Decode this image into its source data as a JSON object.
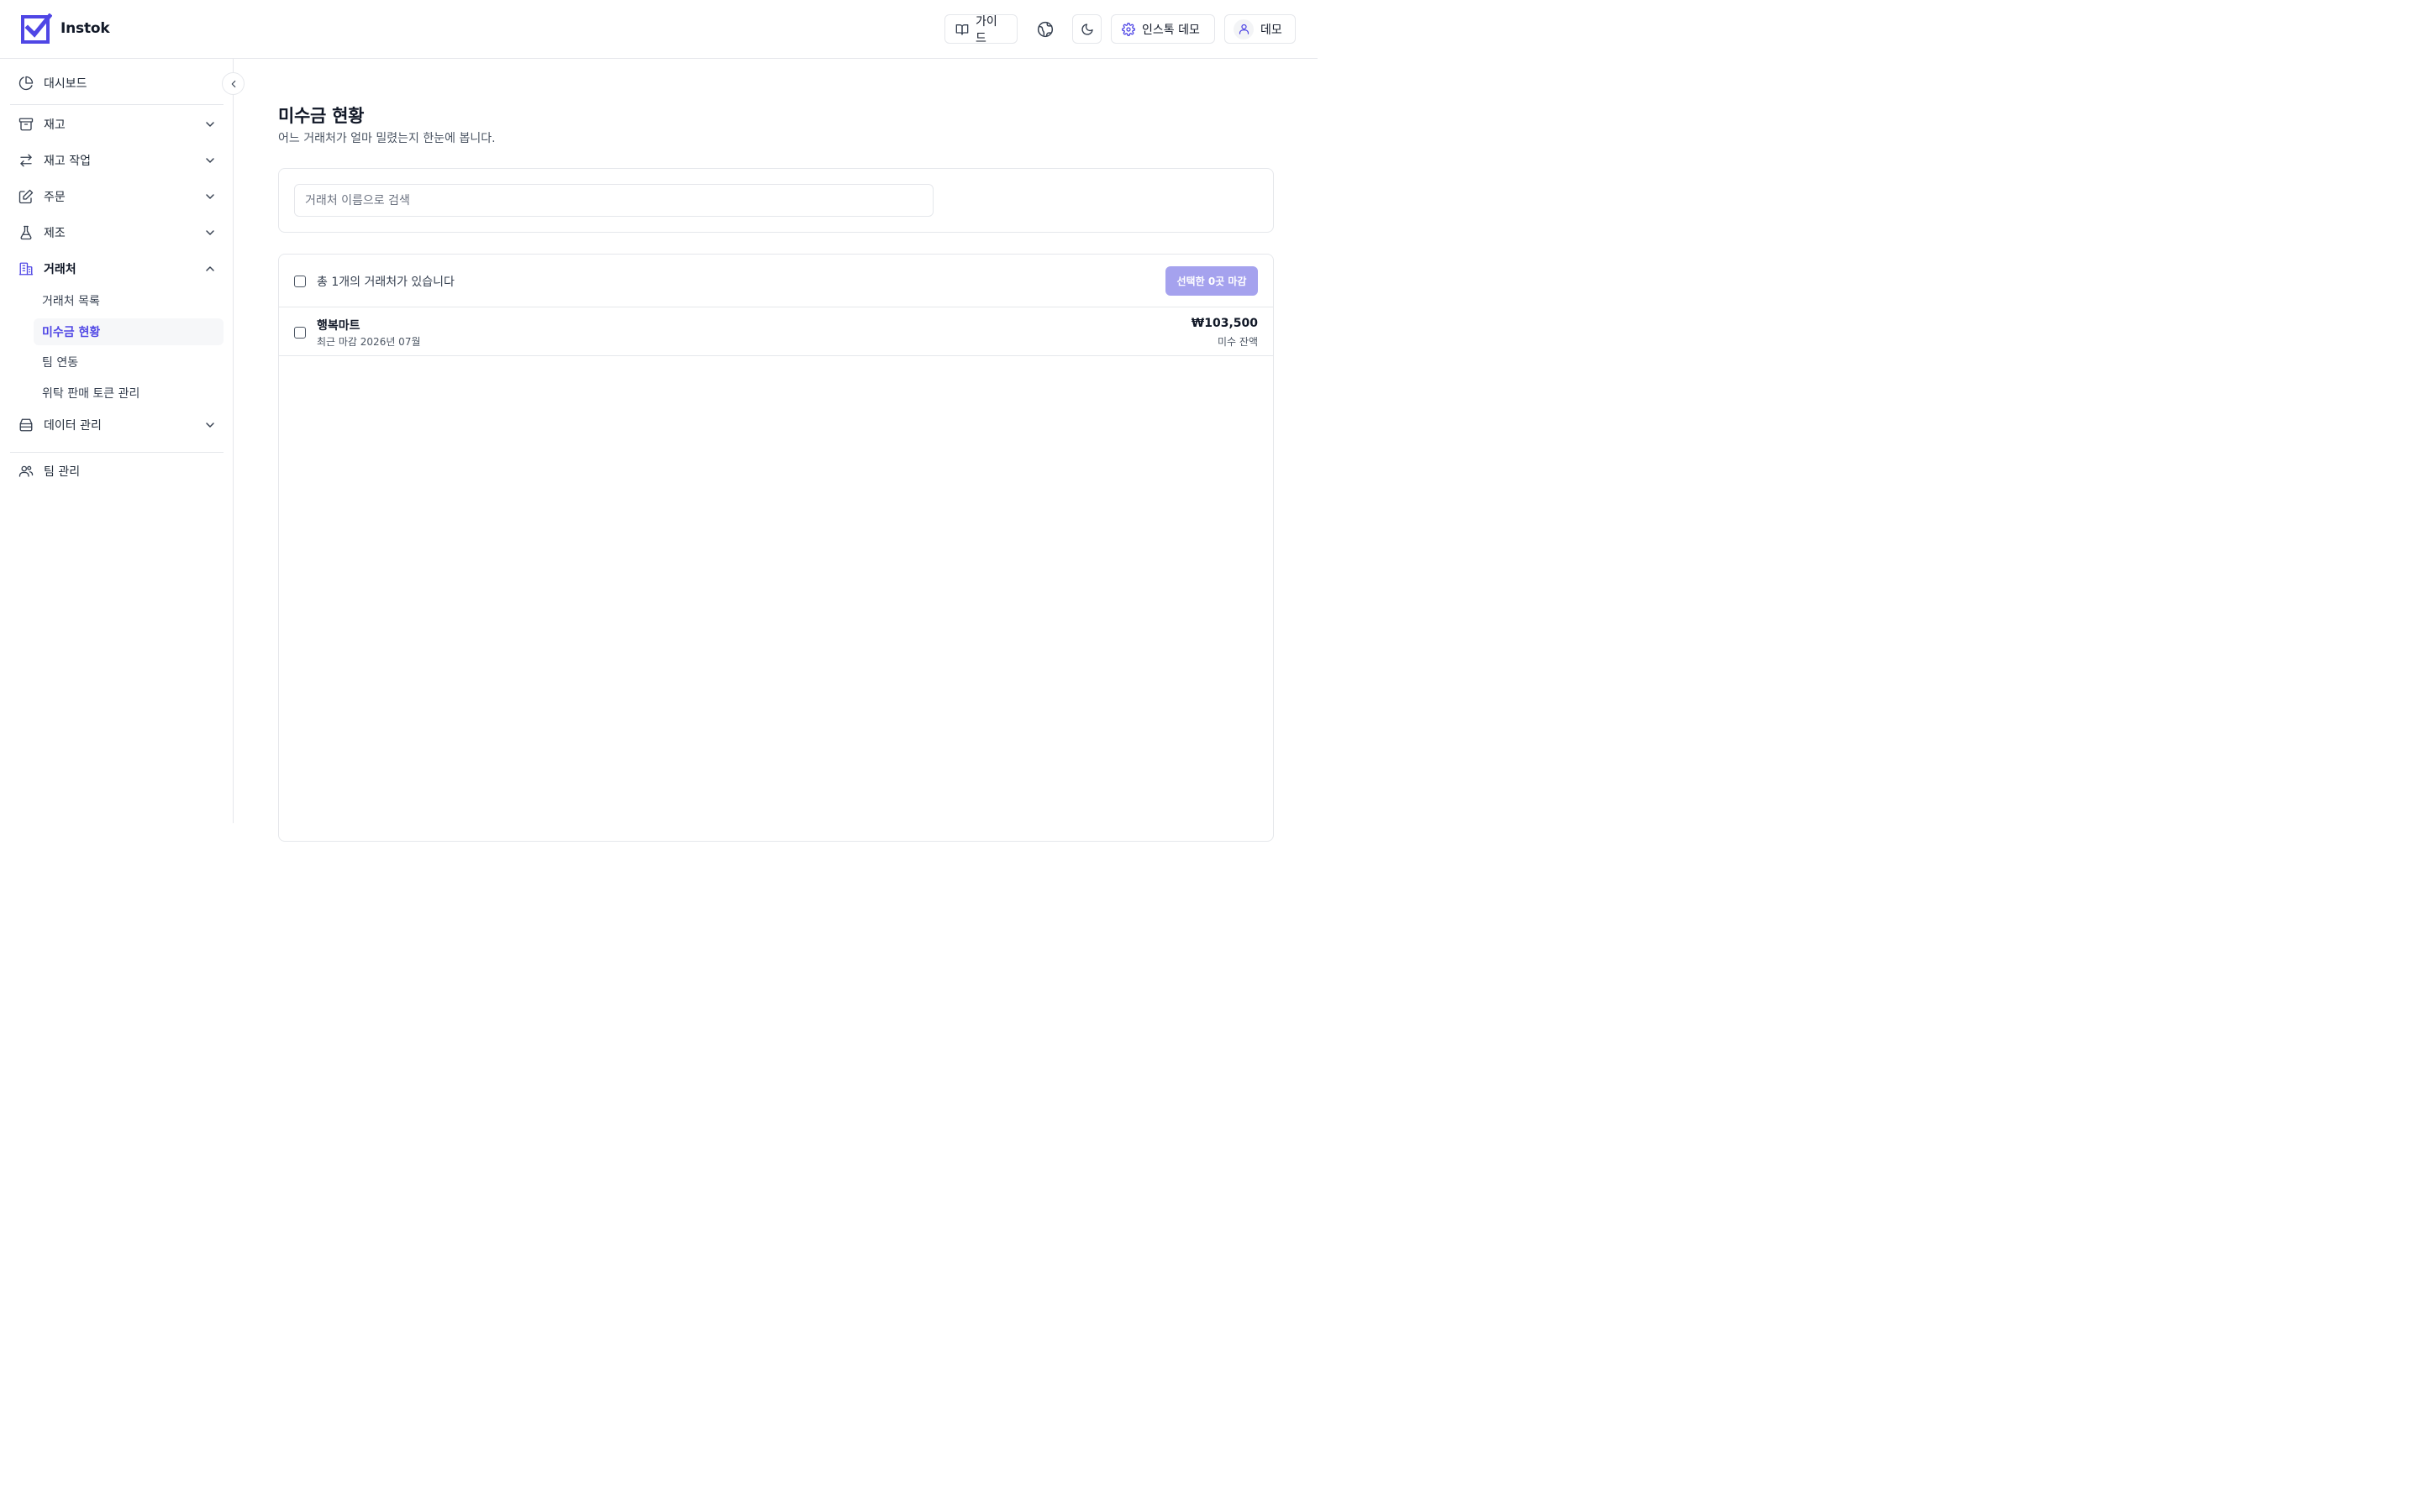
{
  "app": {
    "name": "Instok"
  },
  "header": {
    "guide_label": "가이드",
    "org_label": "인스톡 데모",
    "user_label": "데모"
  },
  "sidebar": {
    "dashboard": "대시보드",
    "inventory": "재고",
    "inventory_ops": "재고 작업",
    "orders": "주문",
    "manufacturing": "제조",
    "partners": "거래처",
    "partners_sub": [
      "거래처 목록",
      "미수금 현황",
      "팀 연동",
      "위탁 판매 토큰 관리"
    ],
    "data_mgmt": "데이터 관리",
    "team_mgmt": "팀 관리"
  },
  "main": {
    "title": "미수금 현황",
    "subtitle": "어느 거래처가 얼마 밀렸는지 한눈에 봅니다.",
    "search_placeholder": "거래처 이름으로 검색",
    "summary": "총 1개의 거래처가 있습니다",
    "close_button": "선택한 0곳 마감",
    "rows": [
      {
        "name": "행복마트",
        "meta": "최근 마감 2026년 07월",
        "amount": "₩103,500",
        "amount_label": "미수 잔액"
      }
    ]
  },
  "colors": {
    "brand": "#4f46e5",
    "button_disabled": "#a5a2ee",
    "border": "#e5e7eb"
  }
}
